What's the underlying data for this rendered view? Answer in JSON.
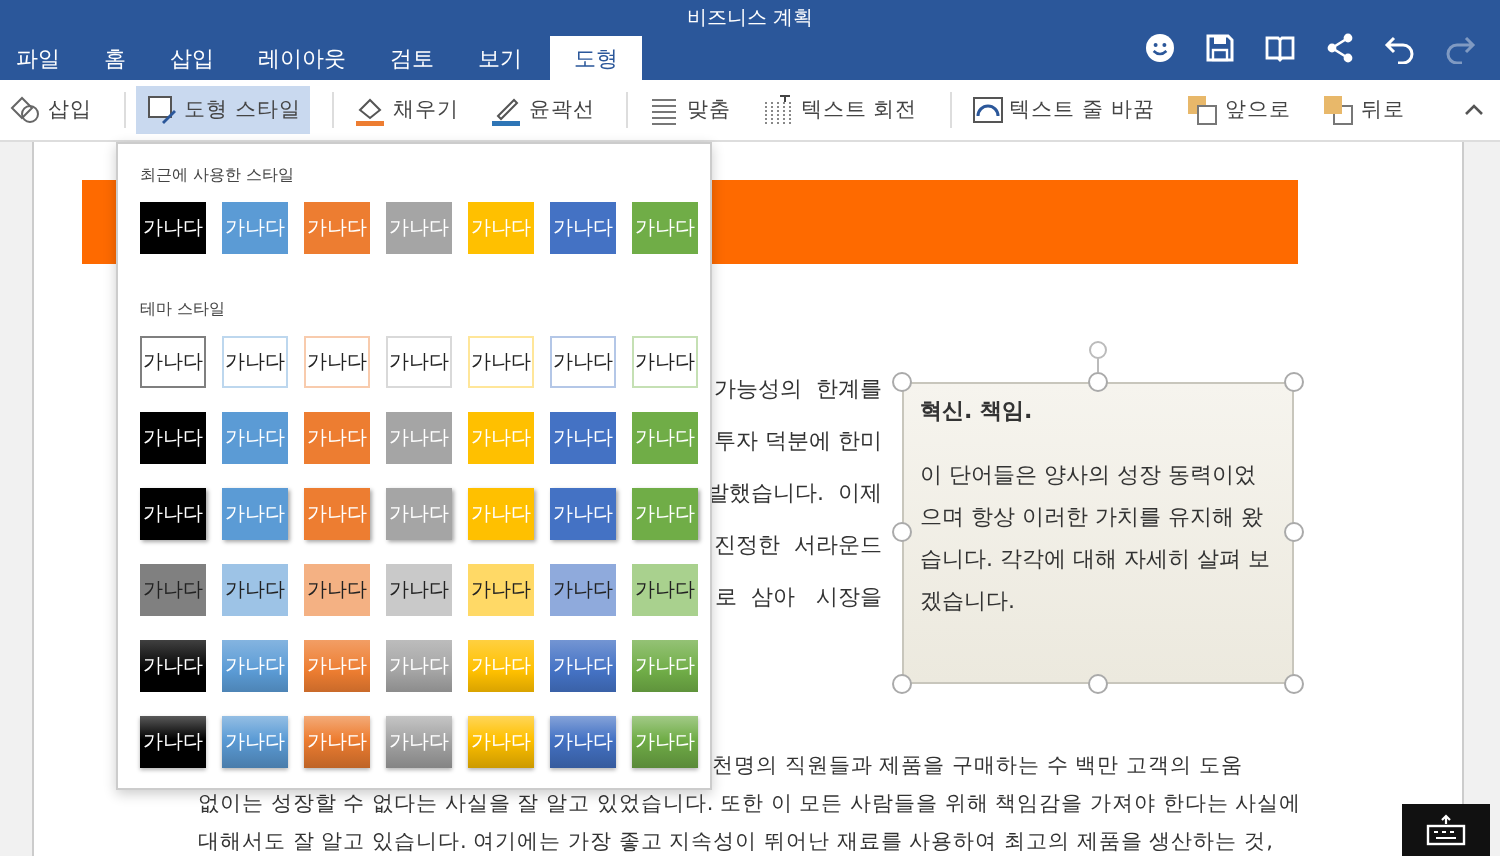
{
  "window": {
    "title": "비즈니스 계획"
  },
  "menu_tabs": [
    {
      "label": "파일",
      "selected": false
    },
    {
      "label": "홈",
      "selected": false
    },
    {
      "label": "삽입",
      "selected": false
    },
    {
      "label": "레이아웃",
      "selected": false
    },
    {
      "label": "검토",
      "selected": false
    },
    {
      "label": "보기",
      "selected": false
    },
    {
      "label": "도형",
      "selected": true
    }
  ],
  "title_actions": [
    {
      "disabled": false
    },
    {
      "disabled": false
    },
    {
      "disabled": false
    },
    {
      "disabled": false
    },
    {
      "disabled": false
    },
    {
      "disabled": true
    }
  ],
  "toolbar": {
    "groups": [
      [
        {
          "label": "삽입",
          "selected": false
        }
      ],
      [
        {
          "label": "도형 스타일",
          "selected": true
        }
      ],
      [
        {
          "label": "채우기",
          "selected": false
        },
        {
          "label": "윤곽선",
          "selected": false
        }
      ],
      [
        {
          "label": "맞춤",
          "selected": false
        },
        {
          "label": "텍스트 회전",
          "selected": false
        }
      ],
      [
        {
          "label": "텍스트 줄 바꿈",
          "selected": false
        },
        {
          "label": "앞으로",
          "selected": false
        },
        {
          "label": "뒤로",
          "selected": false
        }
      ]
    ]
  },
  "style_panel": {
    "sections": [
      {
        "title": "최근에 사용한 스타일",
        "rows": [
          {
            "kind": "solid",
            "items": [
              {
                "label": "가나다",
                "color": "#000000"
              },
              {
                "label": "가나다",
                "color": "#5b9bd5"
              },
              {
                "label": "가나다",
                "color": "#ed7d31"
              },
              {
                "label": "가나다",
                "color": "#a5a5a5"
              },
              {
                "label": "가나다",
                "color": "#ffc000"
              },
              {
                "label": "가나다",
                "color": "#4472c4"
              },
              {
                "label": "가나다",
                "color": "#70ad47"
              }
            ]
          }
        ]
      },
      {
        "title": "테마 스타일",
        "rows": [
          {
            "kind": "outline",
            "items": [
              {
                "label": "가나다",
                "color": "#7f7f7f"
              },
              {
                "label": "가나다",
                "color": "#bdd7ee"
              },
              {
                "label": "가나다",
                "color": "#f8cbad"
              },
              {
                "label": "가나다",
                "color": "#d9d9d9"
              },
              {
                "label": "가나다",
                "color": "#ffe699"
              },
              {
                "label": "가나다",
                "color": "#b4c7e7"
              },
              {
                "label": "가나다",
                "color": "#c5e0b4"
              }
            ]
          },
          {
            "kind": "solid",
            "items": [
              {
                "label": "가나다",
                "color": "#000000"
              },
              {
                "label": "가나다",
                "color": "#5b9bd5"
              },
              {
                "label": "가나다",
                "color": "#ed7d31"
              },
              {
                "label": "가나다",
                "color": "#a5a5a5"
              },
              {
                "label": "가나다",
                "color": "#ffc000"
              },
              {
                "label": "가나다",
                "color": "#4472c4"
              },
              {
                "label": "가나다",
                "color": "#70ad47"
              }
            ]
          },
          {
            "kind": "shaded",
            "items": [
              {
                "label": "가나다",
                "color": "#000000"
              },
              {
                "label": "가나다",
                "color": "#5b9bd5"
              },
              {
                "label": "가나다",
                "color": "#ed7d31"
              },
              {
                "label": "가나다",
                "color": "#a5a5a5"
              },
              {
                "label": "가나다",
                "color": "#ffc000"
              },
              {
                "label": "가나다",
                "color": "#4472c4"
              },
              {
                "label": "가나다",
                "color": "#70ad47"
              }
            ]
          },
          {
            "kind": "light",
            "items": [
              {
                "label": "가나다",
                "color": "#808080"
              },
              {
                "label": "가나다",
                "color": "#9dc3e6"
              },
              {
                "label": "가나다",
                "color": "#f4b183"
              },
              {
                "label": "가나다",
                "color": "#c9c9c9"
              },
              {
                "label": "가나다",
                "color": "#ffd966"
              },
              {
                "label": "가나다",
                "color": "#8faadc"
              },
              {
                "label": "가나다",
                "color": "#a9d18e"
              }
            ]
          },
          {
            "kind": "gradient",
            "items": [
              {
                "label": "가나다",
                "color": "#000000"
              },
              {
                "label": "가나다",
                "color": "#5b9bd5"
              },
              {
                "label": "가나다",
                "color": "#ed7d31"
              },
              {
                "label": "가나다",
                "color": "#a5a5a5"
              },
              {
                "label": "가나다",
                "color": "#ffc000"
              },
              {
                "label": "가나다",
                "color": "#4472c4"
              },
              {
                "label": "가나다",
                "color": "#70ad47"
              }
            ]
          },
          {
            "kind": "glossy",
            "items": [
              {
                "label": "가나다",
                "color": "#000000"
              },
              {
                "label": "가나다",
                "color": "#5b9bd5"
              },
              {
                "label": "가나다",
                "color": "#ed7d31"
              },
              {
                "label": "가나다",
                "color": "#a5a5a5"
              },
              {
                "label": "가나다",
                "color": "#ffc000"
              },
              {
                "label": "가나다",
                "color": "#4472c4"
              },
              {
                "label": "가나다",
                "color": "#70ad47"
              }
            ]
          }
        ]
      }
    ]
  },
  "document": {
    "side_lines": [
      "가능성의  한계를",
      "투자 덕분에 한미",
      "발했습니다.  이제",
      "진정한  서라운드",
      "로  삼아   시장을"
    ],
    "text_box": {
      "title": "혁신. 책임.",
      "body": "이 단어들은 양사의 성장 동력이었으며 항상 이러한 가치를 유지해 왔습니다. 각각에 대해 자세히 살펴 보겠습니다."
    },
    "bottom_lines": [
      "천명의 직원들과 제품을 구매하는 수 백만 고객의 도움",
      "없이는 성장할 수 없다는 사실을 잘 알고 있었습니다. 또한 이 모든 사람들을 위해 책임감을 가져야 한다는 사실에",
      "대해서도 잘 알고 있습니다. 여기에는 가장 좋고 지속성이 뛰어난 재료를 사용하여 최고의 제품을 생산하는 것,"
    ]
  }
}
